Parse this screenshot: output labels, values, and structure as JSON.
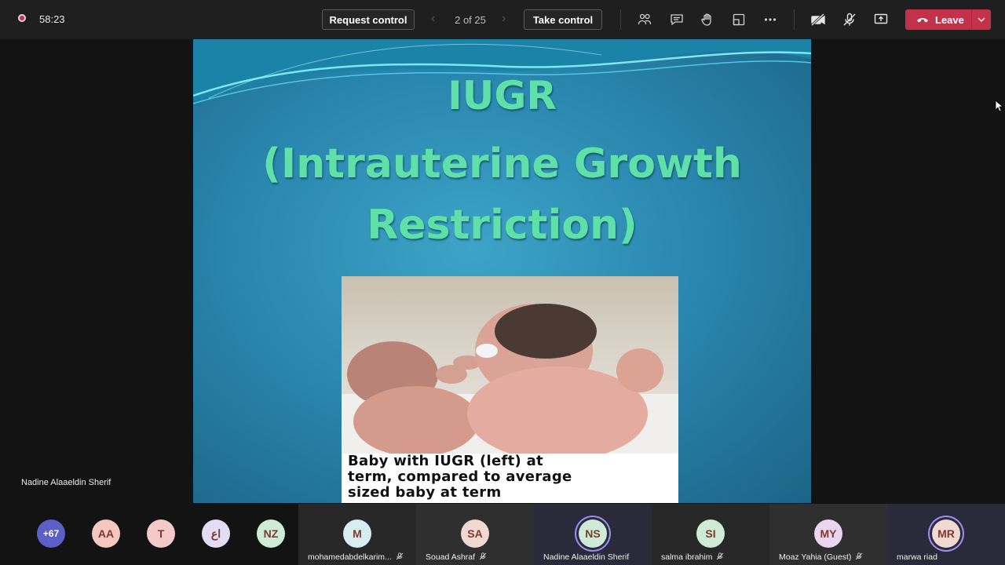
{
  "topbar": {
    "timer": "58:23",
    "request_control": "Request control",
    "pager": "2 of 25",
    "take_control": "Take control",
    "leave": "Leave"
  },
  "slide": {
    "title": "IUGR",
    "subtitle_line1": "(Intrauterine Growth",
    "subtitle_line2": "Restriction)",
    "caption_line1": "Baby with IUGR (left) at",
    "caption_line2": "term, compared to average",
    "caption_line3": "sized baby at term"
  },
  "presenter": "Nadine Alaaeldin Sherif",
  "overflow_count": "+67",
  "small_avatars": [
    {
      "initials": "AA",
      "color": "#f4c8c0"
    },
    {
      "initials": "T",
      "color": "#f4c9c9"
    },
    {
      "initials": "اع",
      "color": "#e2dcf4"
    },
    {
      "initials": "NZ",
      "color": "#cdebd6"
    }
  ],
  "tiles": [
    {
      "initials": "M",
      "name": "mohamedabdelkarim...",
      "color": "#d6eef0"
    },
    {
      "initials": "SA",
      "name": "Souad Ashraf",
      "color": "#f2d8d2"
    },
    {
      "initials": "NS",
      "name": "Nadine Alaaeldin Sherif",
      "color": "#cdebd6"
    },
    {
      "initials": "SI",
      "name": "salma ibrahim",
      "color": "#cdebd6"
    },
    {
      "initials": "MY",
      "name": "Moaz Yahia (Guest)",
      "color": "#ead6ee"
    },
    {
      "initials": "MR",
      "name": "marwa riad",
      "color": "#f2d8d2"
    }
  ]
}
